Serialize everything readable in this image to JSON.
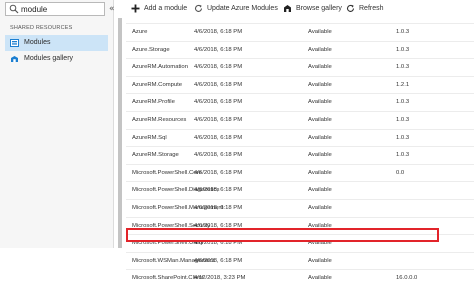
{
  "search": {
    "value": "module",
    "icon": "search-icon"
  },
  "sidebar": {
    "collapse_label": "«",
    "section_header": "SHARED RESOURCES",
    "items": [
      {
        "label": "Modules",
        "icon": "modules-icon",
        "selected": true
      },
      {
        "label": "Modules gallery",
        "icon": "gallery-icon",
        "selected": false
      }
    ]
  },
  "toolbar": {
    "add_label": "Add a module",
    "update_label": "Update Azure Modules",
    "browse_label": "Browse gallery",
    "refresh_label": "Refresh"
  },
  "modules": [
    {
      "name": "Azure",
      "modified": "4/6/2018, 6:18 PM",
      "status": "Available",
      "version": "1.0.3"
    },
    {
      "name": "Azure.Storage",
      "modified": "4/6/2018, 6:18 PM",
      "status": "Available",
      "version": "1.0.3"
    },
    {
      "name": "AzureRM.Automation",
      "modified": "4/6/2018, 6:18 PM",
      "status": "Available",
      "version": "1.0.3"
    },
    {
      "name": "AzureRM.Compute",
      "modified": "4/6/2018, 6:18 PM",
      "status": "Available",
      "version": "1.2.1"
    },
    {
      "name": "AzureRM.Profile",
      "modified": "4/6/2018, 6:18 PM",
      "status": "Available",
      "version": "1.0.3"
    },
    {
      "name": "AzureRM.Resources",
      "modified": "4/6/2018, 6:18 PM",
      "status": "Available",
      "version": "1.0.3"
    },
    {
      "name": "AzureRM.Sql",
      "modified": "4/6/2018, 6:18 PM",
      "status": "Available",
      "version": "1.0.3"
    },
    {
      "name": "AzureRM.Storage",
      "modified": "4/6/2018, 6:18 PM",
      "status": "Available",
      "version": "1.0.3"
    },
    {
      "name": "Microsoft.PowerShell.Core",
      "modified": "4/6/2018, 6:18 PM",
      "status": "Available",
      "version": "0.0"
    },
    {
      "name": "Microsoft.PowerShell.Diagnostics",
      "modified": "4/6/2018, 6:18 PM",
      "status": "Available",
      "version": ""
    },
    {
      "name": "Microsoft.PowerShell.Management",
      "modified": "4/6/2018, 6:18 PM",
      "status": "Available",
      "version": ""
    },
    {
      "name": "Microsoft.PowerShell.Security",
      "modified": "4/6/2018, 6:18 PM",
      "status": "Available",
      "version": ""
    },
    {
      "name": "Microsoft.PowerShell.Utility",
      "modified": "4/6/2018, 6:18 PM",
      "status": "Available",
      "version": ""
    },
    {
      "name": "Microsoft.WSMan.Management",
      "modified": "4/6/2018, 6:18 PM",
      "status": "Available",
      "version": ""
    },
    {
      "name": "Microsoft.SharePoint.Client",
      "modified": "4/12/2018, 3:23 PM",
      "status": "Available",
      "version": "16.0.0.0",
      "highlighted": true
    }
  ],
  "colors": {
    "highlight": "#e2242a",
    "selected_nav": "#cce4f7",
    "accent": "#1c7fd1"
  }
}
